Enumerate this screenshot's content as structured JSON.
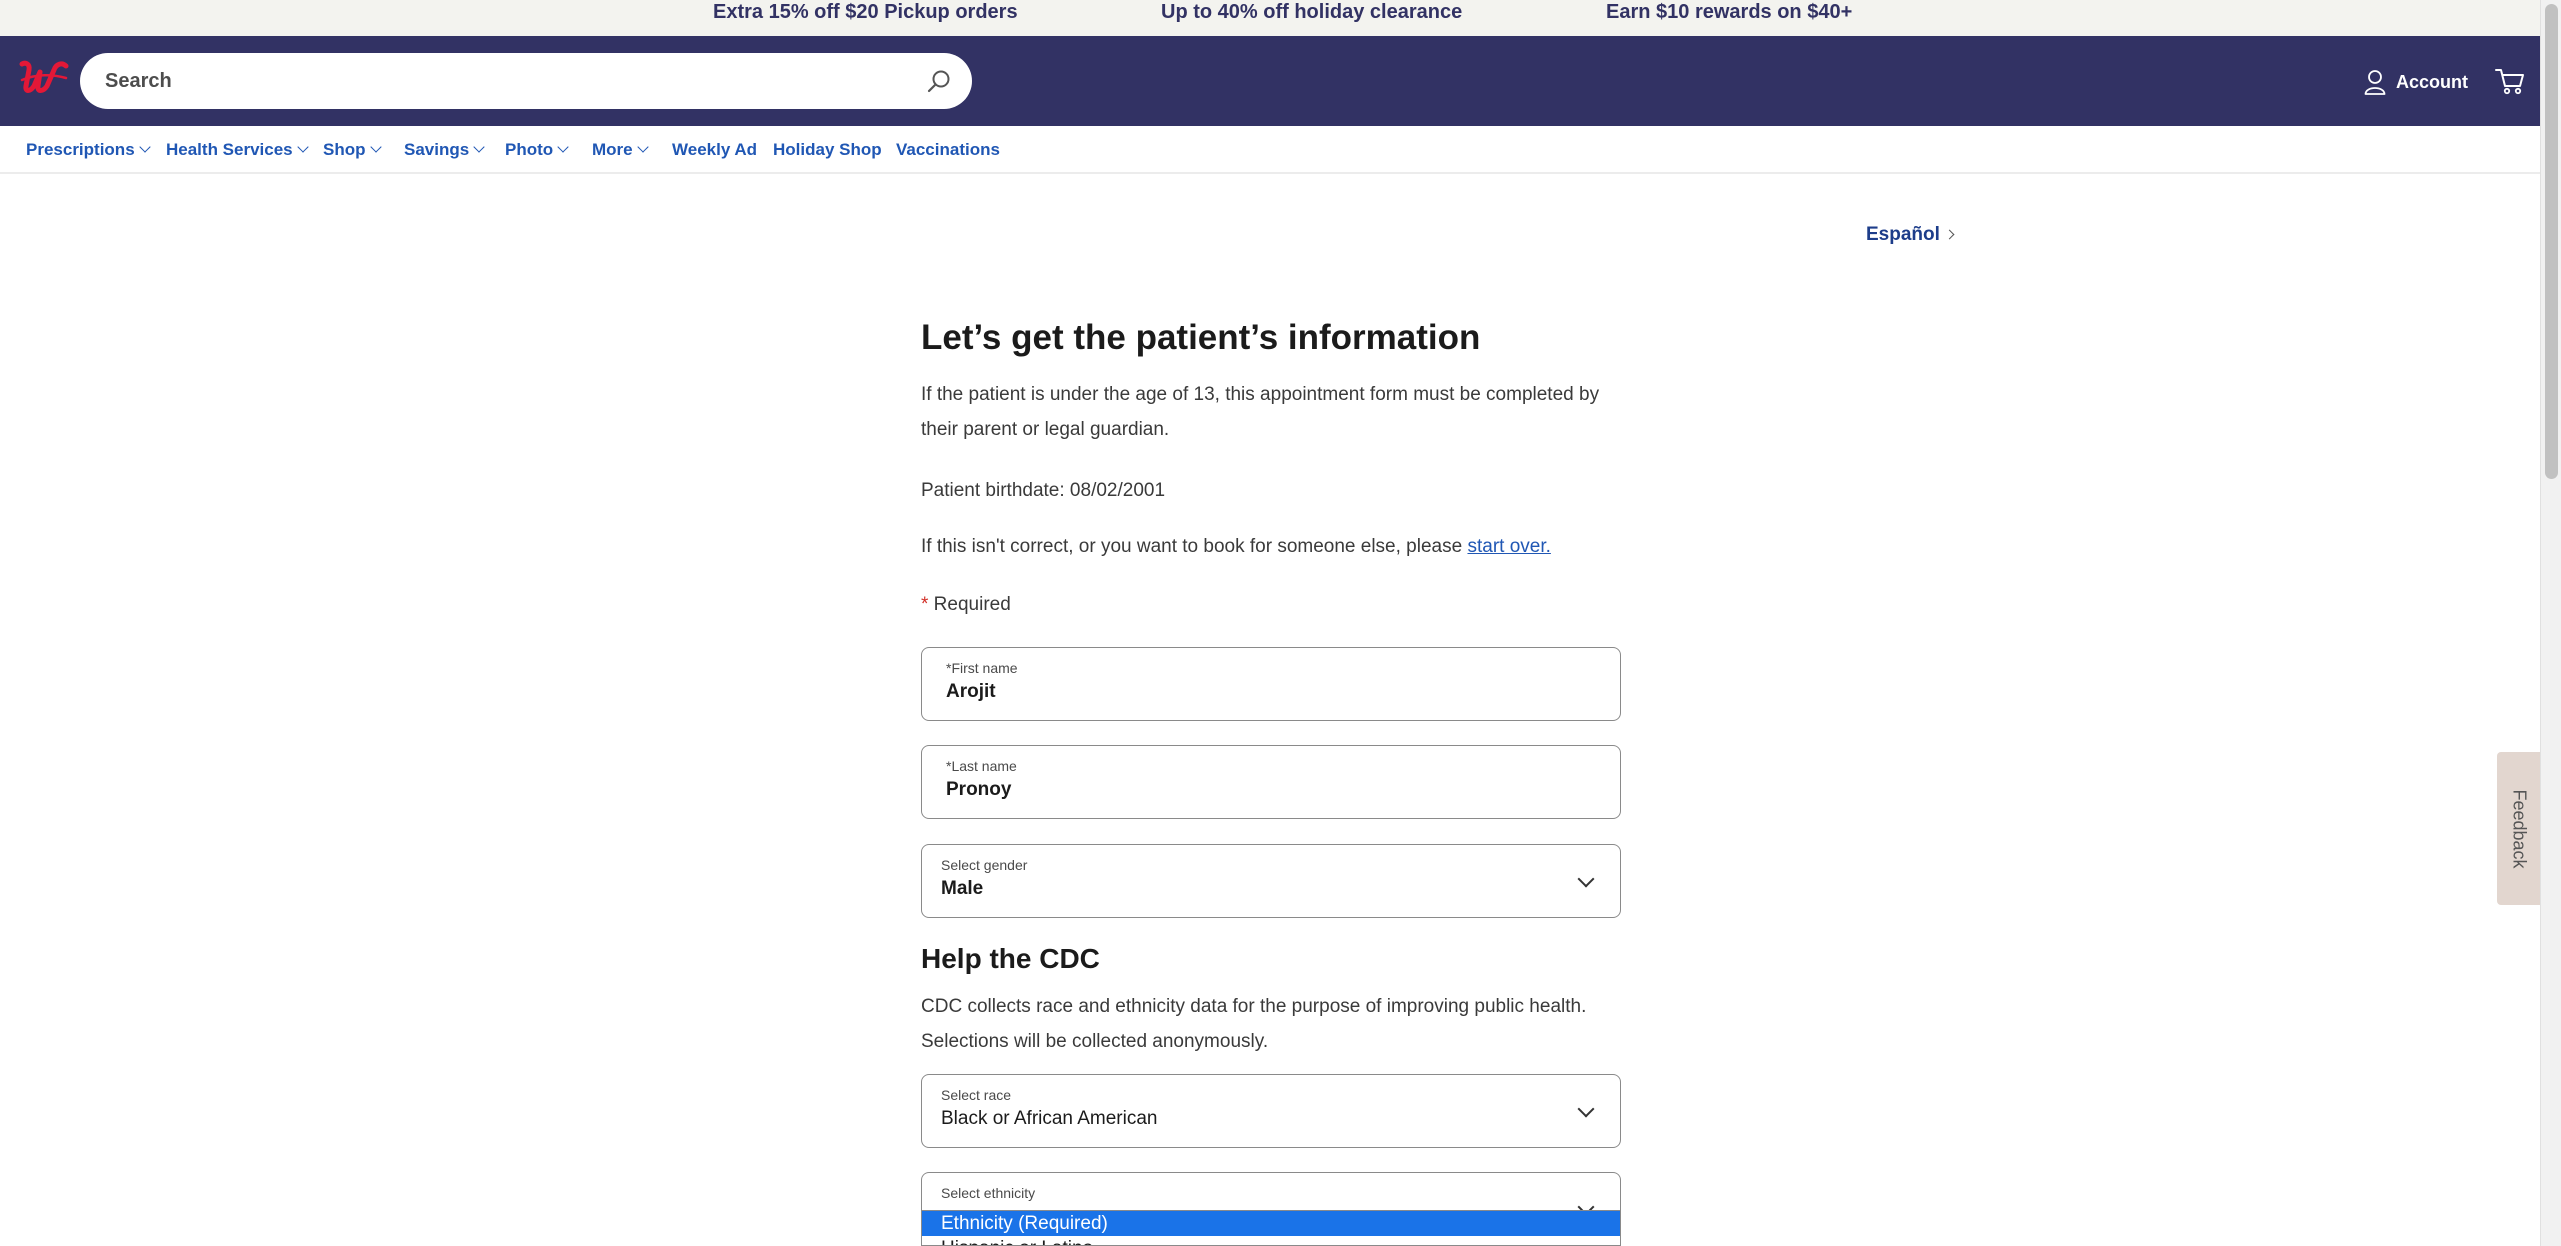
{
  "promo": {
    "items": [
      "Extra 15% off $20 Pickup orders",
      "Up to 40% off holiday clearance",
      "Earn $10 rewards on $40+"
    ]
  },
  "header": {
    "logo_icon": "walgreens-logo-icon",
    "search_placeholder": "Search",
    "account_label": "Account",
    "brand_color": "#323264",
    "logo_color": "#e31837"
  },
  "nav": {
    "items": [
      {
        "label": "Prescriptions",
        "dropdown": true
      },
      {
        "label": "Health Services",
        "dropdown": true
      },
      {
        "label": "Shop",
        "dropdown": true
      },
      {
        "label": "Savings",
        "dropdown": true
      },
      {
        "label": "Photo",
        "dropdown": true
      },
      {
        "label": "More",
        "dropdown": true
      },
      {
        "label": "Weekly Ad",
        "dropdown": false
      },
      {
        "label": "Holiday Shop",
        "dropdown": false
      },
      {
        "label": "Vaccinations",
        "dropdown": false
      }
    ]
  },
  "language_link": "Español",
  "form": {
    "title": "Let’s get the patient’s information",
    "intro_line1": "If the patient is under the age of 13, this appointment form must be completed by",
    "intro_line2": "their parent or legal guardian.",
    "birthdate_label": "Patient birthdate: 08/02/2001",
    "restart_prefix": "If this isn't correct, or you want to book for someone else, please ",
    "restart_link": "start over.",
    "required_star": "*",
    "required_label": " Required",
    "first_name": {
      "label": "*First name",
      "value": "Arojit"
    },
    "last_name": {
      "label": "*Last name",
      "value": "Pronoy"
    },
    "gender": {
      "label": "Select gender",
      "value": "Male"
    },
    "cdc_title": "Help the CDC",
    "cdc_line1": "CDC collects race and ethnicity data for the purpose of improving public health.",
    "cdc_line2": "Selections will be collected anonymously.",
    "race": {
      "label": "Select race",
      "value": "Black or African American"
    },
    "ethnicity": {
      "label": "Select ethnicity",
      "options": [
        "Ethnicity (Required)",
        "Hispanic or Latino"
      ],
      "highlighted_option": "Ethnicity (Required)"
    }
  },
  "feedback_label": "Feedback",
  "link_color": "#2057b4"
}
